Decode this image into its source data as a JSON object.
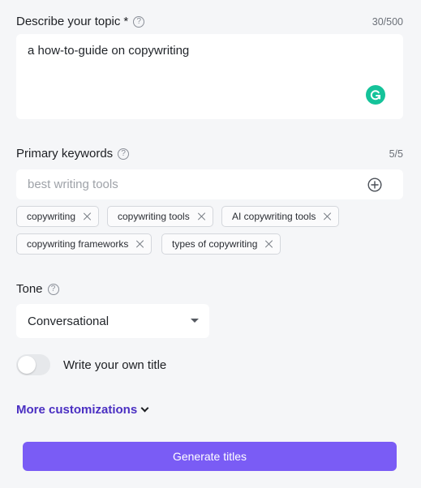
{
  "topic": {
    "label": "Describe your topic",
    "required_marker": "*",
    "counter": "30/500",
    "value": "a how-to-guide on copywriting"
  },
  "keywords": {
    "label": "Primary keywords",
    "counter": "5/5",
    "placeholder": "best writing tools",
    "chips": [
      "copywriting",
      "copywriting tools",
      "AI copywriting tools",
      "copywriting frameworks",
      "types of copywriting"
    ]
  },
  "tone": {
    "label": "Tone",
    "selected": "Conversational"
  },
  "own_title": {
    "label": "Write your own title",
    "enabled": false
  },
  "more_customizations": "More customizations",
  "generate_button": "Generate titles",
  "colors": {
    "accent": "#7a5cf5",
    "link": "#4a2fc2",
    "grammarly": "#15c39a"
  }
}
